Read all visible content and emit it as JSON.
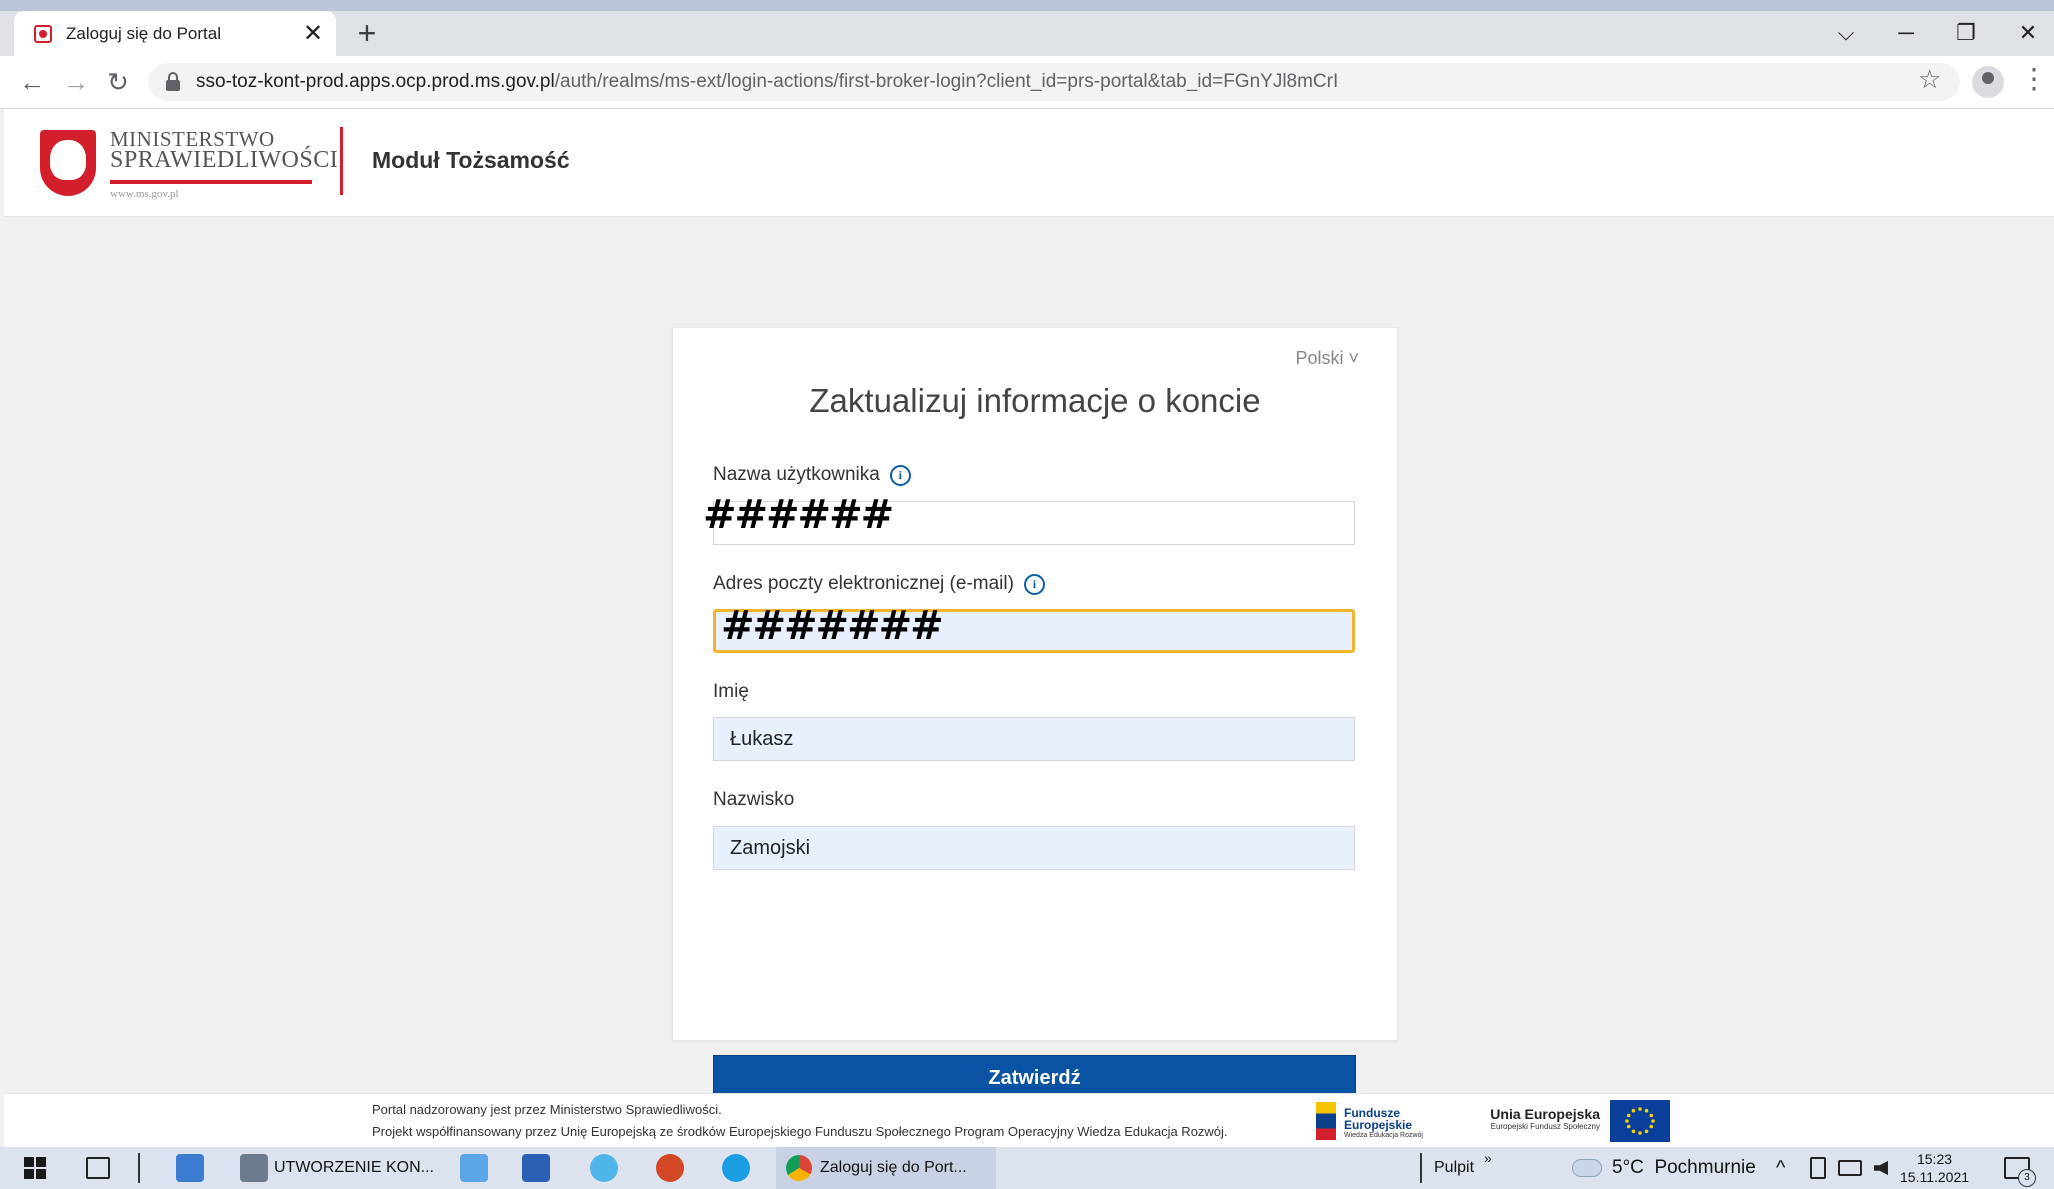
{
  "browser": {
    "tab_title": "Zaloguj się do Portal",
    "tab_close": "✕",
    "new_tab": "+",
    "url_host": "sso-toz-kont-prod.apps.ocp.prod.ms.gov.pl",
    "url_path": "/auth/realms/ms-ext/login-actions/first-broker-login?client_id=prs-portal&tab_id=FGnYJl8mCrI",
    "back": "←",
    "forward": "→",
    "reload": "↻",
    "bookmark": "☆",
    "menu": "⋮",
    "tab_search": "⌵",
    "minimize": "─",
    "restore": "❐",
    "close": "✕"
  },
  "header": {
    "ministry_line1": "MINISTERSTWO",
    "ministry_line2": "SPRAWIEDLIWOŚCI",
    "ministry_url": "www.ms.gov.pl",
    "module_title": "Moduł Tożsamość"
  },
  "form": {
    "language": "Polski ˅",
    "title": "Zaktualizuj informacje o koncie",
    "username_label": "Nazwa użytkownika",
    "username_mask": "######",
    "email_label": "Adres poczty elektronicznej (e-mail)",
    "email_mask": "#######",
    "info_glyph": "i",
    "firstname_label": "Imię",
    "firstname_value": "Łukasz",
    "lastname_label": "Nazwisko",
    "lastname_value": "Zamojski",
    "submit_label": "Zatwierdź"
  },
  "footer": {
    "line1": "Portal nadzorowany jest przez Ministerstwo Sprawiedliwości.",
    "line2": "Projekt współfinansowany przez Unię Europejską ze środków Europejskiego Funduszu Społecznego Program Operacyjny Wiedza Edukacja Rozwój.",
    "fe_name_1": "Fundusze",
    "fe_name_2": "Europejskie",
    "fe_sub": "Wiedza Edukacja Rozwój",
    "eu_name": "Unia Europejska",
    "eu_sub": "Europejski Fundusz Społeczny"
  },
  "taskbar": {
    "app1_label": "UTWORZENIE KON...",
    "chrome_label": "Zaloguj się do Port...",
    "desktop_label": "Pulpit",
    "overflow": "»",
    "weather": "5°C  Pochmurnie",
    "tray_up": "^",
    "time": "15:23",
    "date": "15.11.2021",
    "notif_count": "3"
  },
  "colors": {
    "accent_blue": "#0a52a3",
    "brand_red": "#d21f2b",
    "focus_border": "#f0b52a",
    "autofill_bg": "#e8f0fe"
  }
}
